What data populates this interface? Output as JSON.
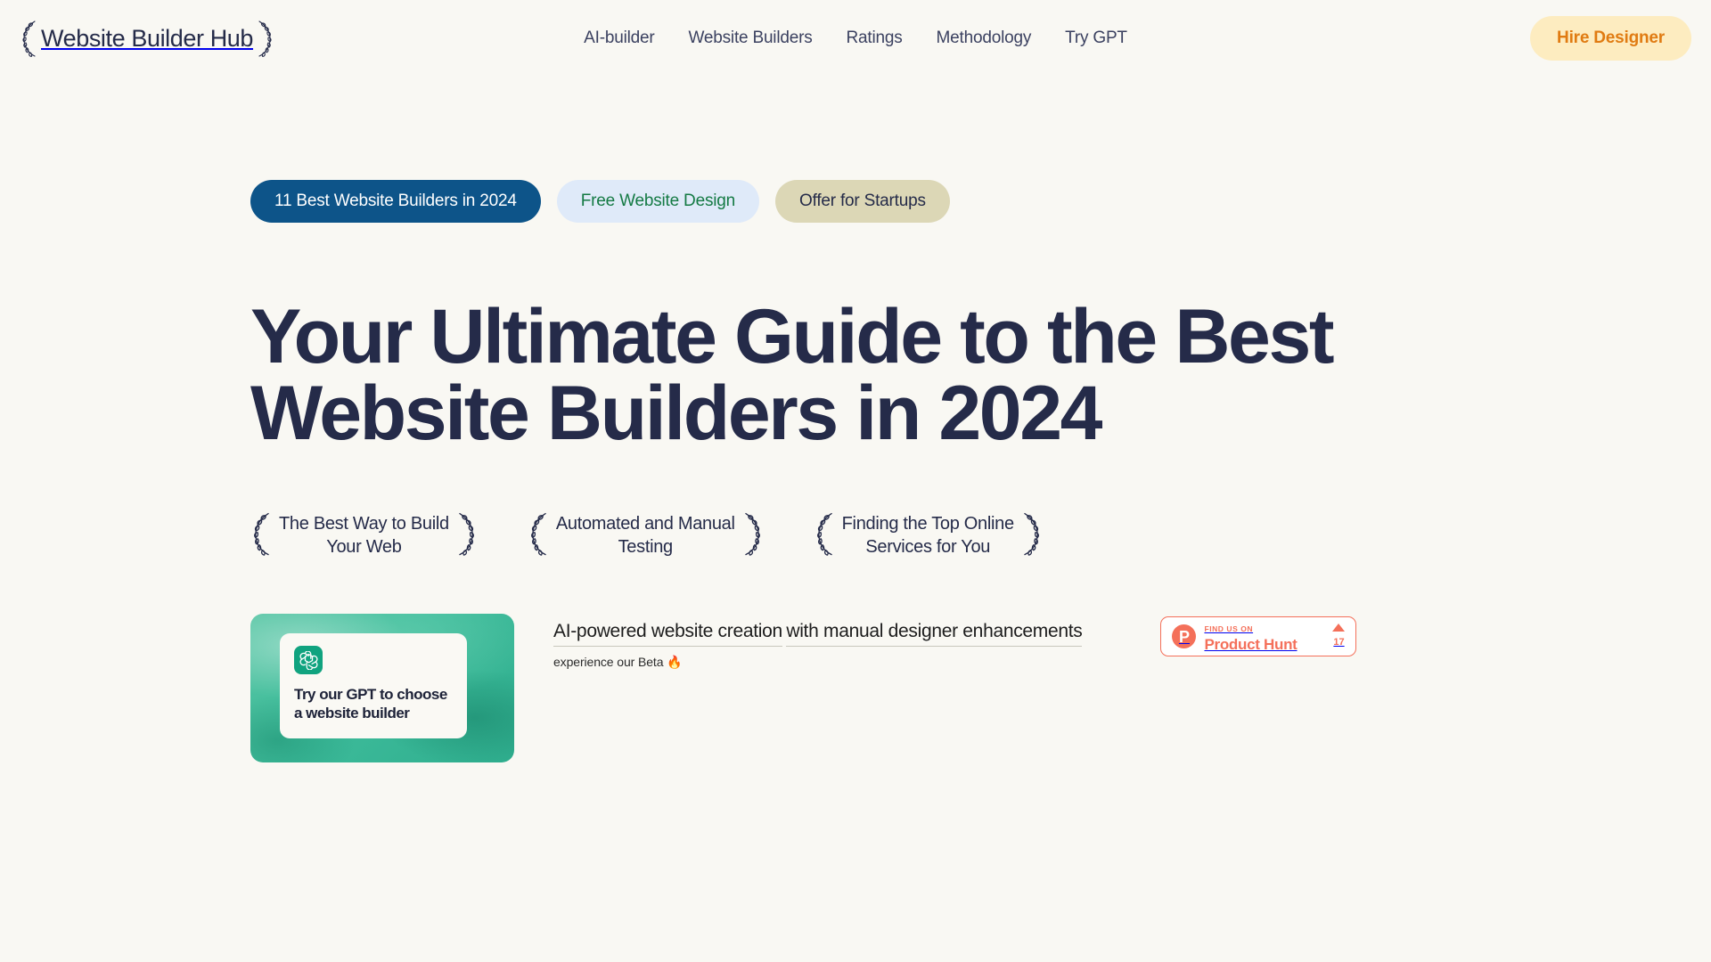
{
  "header": {
    "brand": "Website Builder Hub",
    "logo_icon": "laurel-wreath-icon",
    "nav": [
      {
        "label": "AI-builder"
      },
      {
        "label": "Website Builders"
      },
      {
        "label": "Ratings"
      },
      {
        "label": "Methodology"
      },
      {
        "label": "Try GPT"
      }
    ],
    "cta": {
      "label": "Hire Designer"
    }
  },
  "hero": {
    "pills": [
      {
        "label": "11 Best Website Builders in 2024",
        "style": "primary"
      },
      {
        "label": "Free Website Design",
        "style": "secondary"
      },
      {
        "label": "Offer for Startups",
        "style": "tertiary"
      }
    ],
    "title": "Your Ultimate Guide to the Best Website Builders in 2024",
    "badges": [
      {
        "label": "The Best Way to Build\nYour Web"
      },
      {
        "label": "Automated and Manual\nTesting"
      },
      {
        "label": "Finding the Top Online\nServices for You"
      }
    ],
    "gpt_card": {
      "icon": "openai-logo-icon",
      "text": "Try our GPT to choose\na website builder"
    },
    "ai_copy": {
      "line1": "AI-powered website creation",
      "line2": "with manual designer enhancements",
      "sub": "experience our Beta 🔥"
    },
    "product_hunt": {
      "logo_letter": "P",
      "eyebrow": "FIND US ON",
      "name": "Product Hunt",
      "votes": "17"
    }
  },
  "colors": {
    "background": "#f9f8f3",
    "ink": "#252b49",
    "pill_primary_bg": "#0d5489",
    "pill_secondary_bg": "#dfeaf9",
    "pill_secondary_text": "#147a44",
    "pill_tertiary_bg": "#dcd7b6",
    "cta_bg": "#fdecc0",
    "cta_text": "#e07b12",
    "openai_green": "#10a37f",
    "product_hunt": "#f4705a"
  }
}
